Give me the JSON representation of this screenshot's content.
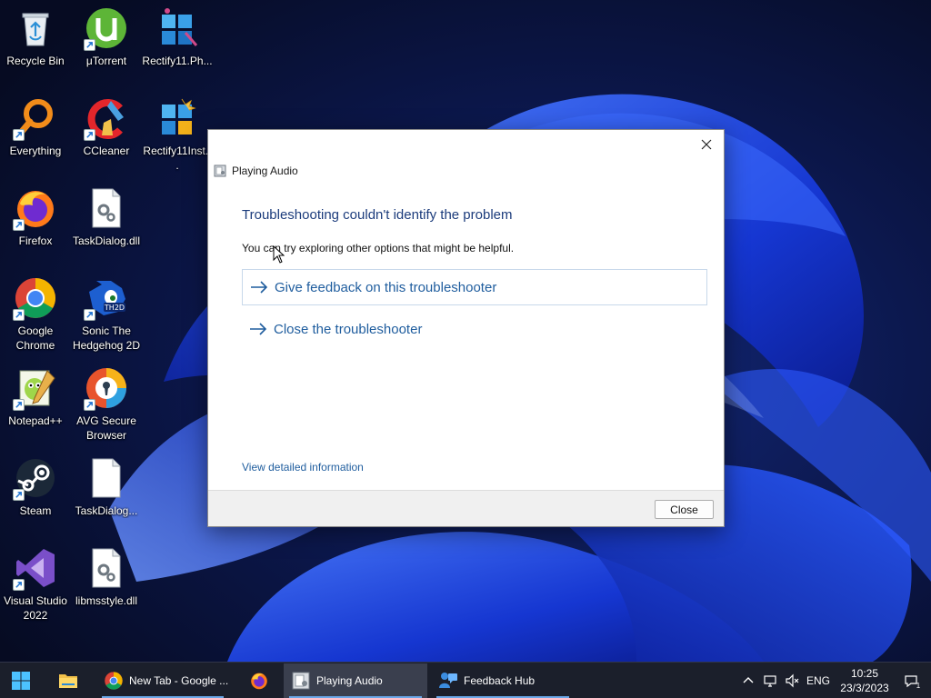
{
  "desktop": {
    "icons": [
      {
        "label": "Recycle Bin",
        "icon": "recycle-bin-icon"
      },
      {
        "label": "μTorrent",
        "icon": "utorrent-icon"
      },
      {
        "label": "Rectify11.Ph...",
        "icon": "rectify11-icon"
      },
      {
        "label": "Everything",
        "icon": "everything-search-icon"
      },
      {
        "label": "CCleaner",
        "icon": "ccleaner-icon"
      },
      {
        "label": "Rectify11Inst...",
        "icon": "rectify11-installer-icon"
      },
      {
        "label": "Firefox",
        "icon": "firefox-icon"
      },
      {
        "label": "TaskDialog.dll",
        "icon": "dll-file-icon"
      },
      {
        "label": "Google Chrome",
        "icon": "chrome-icon"
      },
      {
        "label": "Sonic The Hedgehog 2D",
        "icon": "sonic-icon"
      },
      {
        "label": "Notepad++",
        "icon": "notepad-plus-plus-icon"
      },
      {
        "label": "AVG Secure Browser",
        "icon": "avg-browser-icon"
      },
      {
        "label": "Steam",
        "icon": "steam-icon"
      },
      {
        "label": "TaskDialog...",
        "icon": "blank-file-icon"
      },
      {
        "label": "Visual Studio 2022",
        "icon": "visual-studio-icon"
      },
      {
        "label": "libmsstyle.dll",
        "icon": "dll-file-icon"
      }
    ]
  },
  "dialog": {
    "window_title": "Playing Audio",
    "heading": "Troubleshooting couldn't identify the problem",
    "subtext": "You can try exploring other options that might be helpful.",
    "options": [
      {
        "label": "Give feedback on this troubleshooter"
      },
      {
        "label": "Close the troubleshooter"
      }
    ],
    "detail_link": "View detailed information",
    "close_button": "Close",
    "accent_color": "#1f5d9e",
    "heading_color": "#1c3c7c"
  },
  "taskbar": {
    "apps": [
      {
        "label": "New Tab - Google ...",
        "icon": "chrome-icon"
      },
      {
        "label": "Playing Audio",
        "icon": "troubleshooter-icon"
      },
      {
        "label": "Feedback Hub",
        "icon": "feedback-hub-icon"
      }
    ],
    "language": "ENG",
    "time": "10:25",
    "date": "23/3/2023",
    "notification_count": "1"
  }
}
